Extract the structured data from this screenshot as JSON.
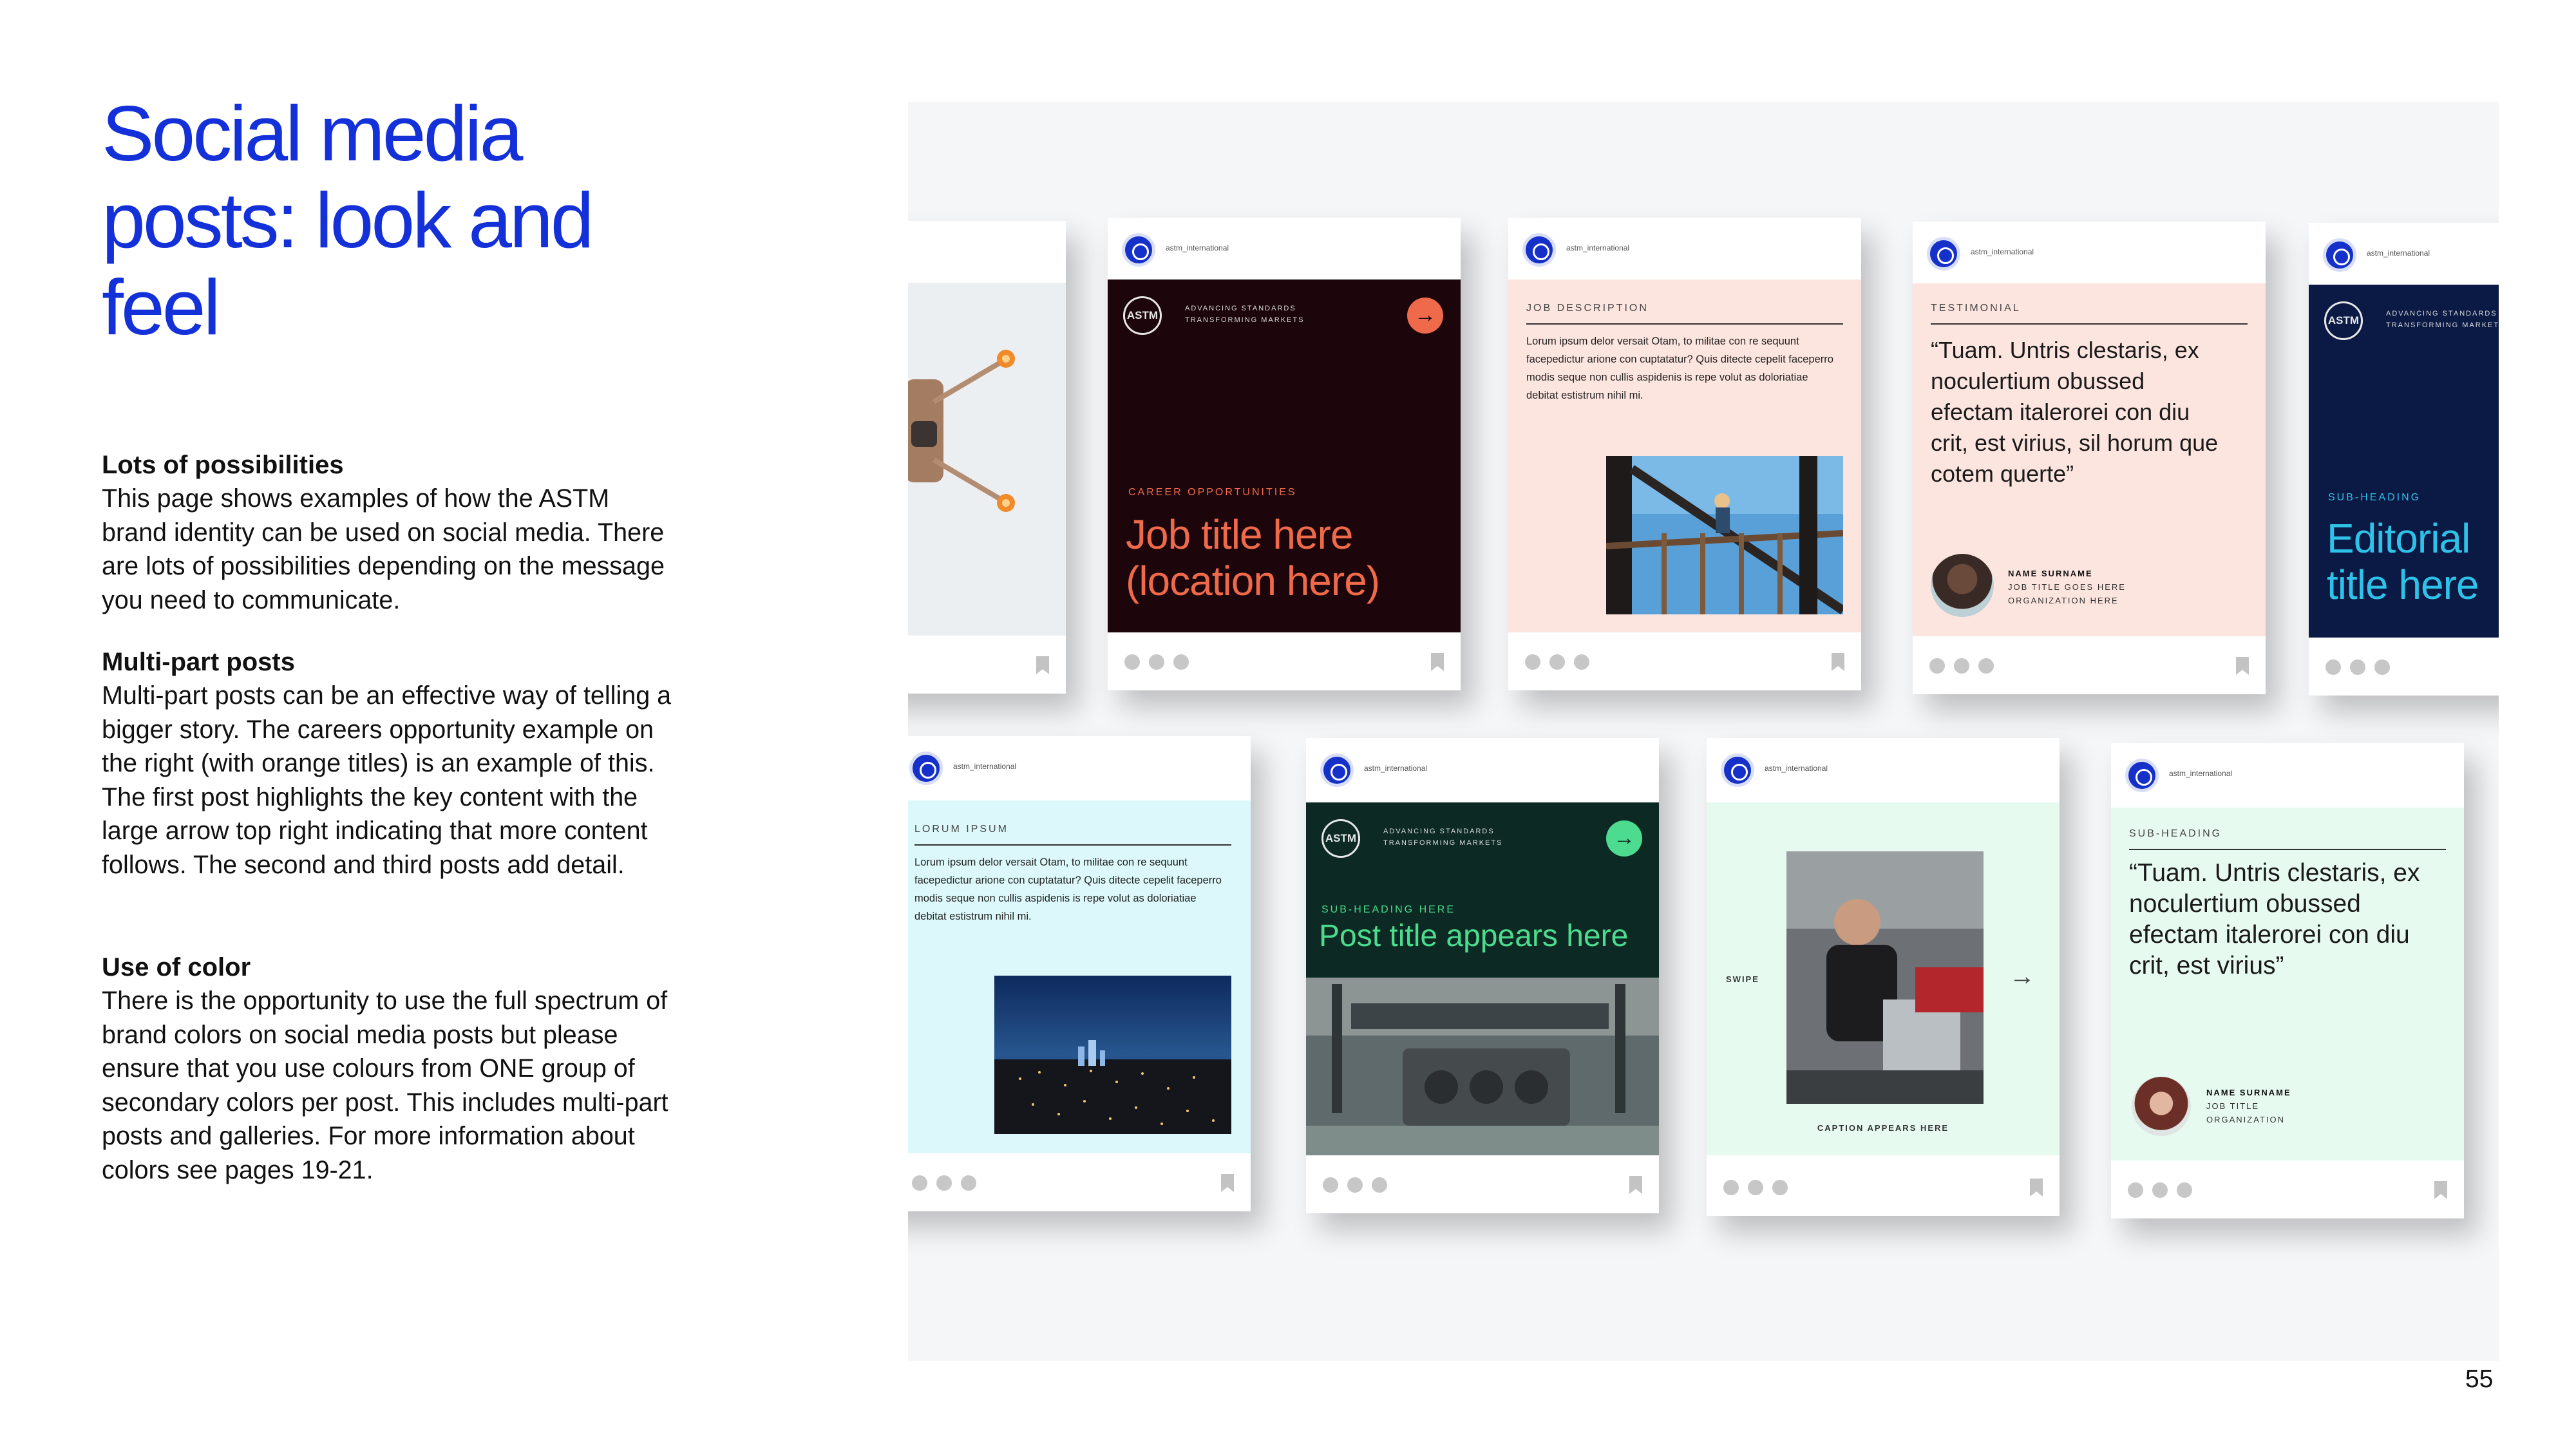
{
  "title": "Social media posts: look and feel",
  "sections": [
    {
      "heading": "Lots of possibilities",
      "text": "This page shows examples of how the ASTM brand identity can be used on social media. There are lots of possibilities depending on the message you need to communicate."
    },
    {
      "heading": "Multi-part posts",
      "text": "Multi-part posts can be an effective way of telling a bigger story. The careers opportunity example on the right (with orange titles) is an example of this. The first post highlights the key content with the large arrow top right indicating that more content follows. The second and third posts add detail."
    },
    {
      "heading": "Use of color",
      "text": "There is the opportunity to use the full spectrum of brand colors on social media posts but please ensure that you use colours from ONE group of secondary colors per post. This includes multi-part posts and galleries. For more information about colors see pages 19-21."
    }
  ],
  "page_number": "55",
  "handle": "astm_international",
  "brand_lines": [
    "ADVANCING STANDARDS",
    "TRANSFORMING MARKETS"
  ],
  "astm_mark": "ASTM",
  "arrow_glyph": "→",
  "posts": {
    "career": {
      "kicker": "CAREER OPPORTUNITIES",
      "title": "Job title here (location here)",
      "bg": "#1c060c",
      "accent": "#ef6a4a"
    },
    "job": {
      "kicker": "JOB DESCRIPTION",
      "body": "Lorum ipsum delor versait Otam, to militae con re sequunt facepedictur arione con cuptatatur? Quis ditecte cepelit faceperro modis seque non cullis aspidenis is repe volut as doloriatiae debitat estistrum nihil mi.",
      "bg": "#fde5df"
    },
    "testimonial": {
      "kicker": "TESTIMONIAL",
      "quote": "“Tuam. Untris clestaris, ex noculertium obussed efectam italerorei con diu crit, est virius, sil horum que cotem querte”",
      "name": "NAME SURNAME",
      "role": "JOB TITLE GOES HERE",
      "org": "ORGANIZATION HERE",
      "bg": "#fde5df"
    },
    "editorial": {
      "kicker": "SUB-HEADING",
      "title": "Editorial title here",
      "bg": "#0b1a45",
      "accent": "#2fc2e8"
    },
    "lorum": {
      "kicker": "LORUM IPSUM",
      "body": "Lorum ipsum delor versait Otam, to militae con re sequunt facepedictur arione con cuptatatur? Quis ditecte cepelit faceperro modis seque non cullis aspidenis is repe volut as doloriatiae debitat estistrum nihil mi.",
      "bg": "#dcf8fb"
    },
    "post": {
      "kicker": "SUB-HEADING HERE",
      "title": "Post title appears here",
      "bg": "#0c2a23",
      "accent": "#4ddc8f"
    },
    "swipe": {
      "label": "SWIPE",
      "caption": "CAPTION APPEARS HERE",
      "bg": "#e7faf0"
    },
    "testimonial2": {
      "kicker": "SUB-HEADING",
      "quote": "“Tuam. Untris clestaris, ex noculertium obussed efectam italerorei con diu crit, est virius”",
      "name": "NAME SURNAME",
      "role": "JOB TITLE",
      "org": "ORGANIZATION",
      "bg": "#e7faf0"
    }
  }
}
